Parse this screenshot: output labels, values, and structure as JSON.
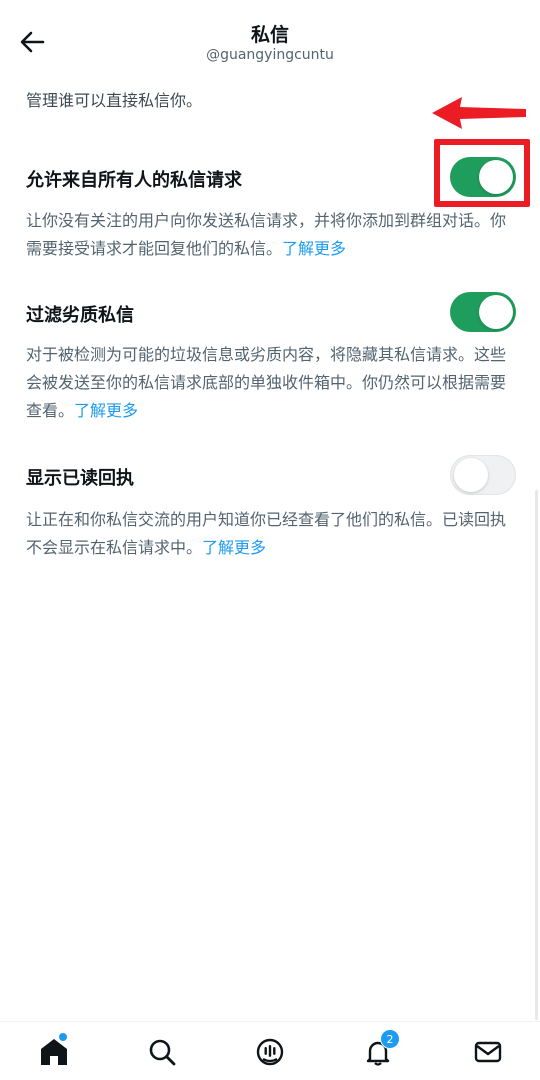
{
  "header": {
    "title": "私信",
    "subtitle": "@guangyingcuntu",
    "back_icon": "arrow-left-icon"
  },
  "intro": "管理谁可以直接私信你。",
  "settings": [
    {
      "title": "允许来自所有人的私信请求",
      "desc": "让你没有关注的用户向你发送私信请求，并将你添加到群组对话。你需要接受请求才能回复他们的私信。",
      "learn_more": "了解更多",
      "enabled": true
    },
    {
      "title": "过滤劣质私信",
      "desc": "对于被检测为可能的垃圾信息或劣质内容，将隐藏其私信请求。这些会被发送至你的私信请求底部的单独收件箱中。你仍然可以根据需要查看。",
      "learn_more": "了解更多",
      "enabled": true
    },
    {
      "title": "显示已读回执",
      "desc": "让正在和你私信交流的用户知道你已经查看了他们的私信。已读回执不会显示在私信请求中。",
      "learn_more": "了解更多",
      "enabled": false
    }
  ],
  "annotation": {
    "color": "#ec1c24",
    "arrow_icon": "red-arrow-left-icon",
    "box": "highlight-box"
  },
  "colors": {
    "toggle_on": "#1f9d5c",
    "link": "#1d9bf0",
    "text_primary": "#0f1419",
    "text_secondary": "#536471"
  },
  "bottom_nav": {
    "items": [
      {
        "icon": "home-icon",
        "has_dot": true
      },
      {
        "icon": "search-icon"
      },
      {
        "icon": "spaces-icon"
      },
      {
        "icon": "bell-icon",
        "badge": "2"
      },
      {
        "icon": "mail-icon"
      }
    ]
  }
}
